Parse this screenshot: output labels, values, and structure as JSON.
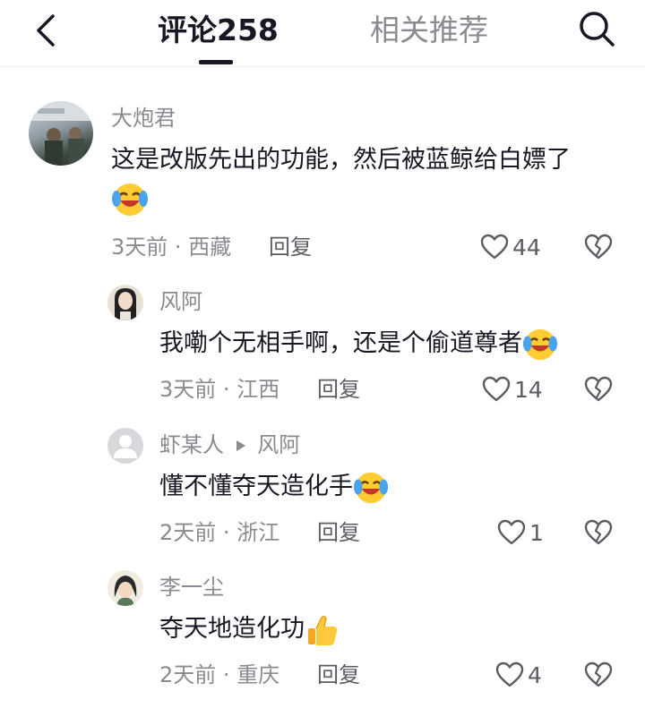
{
  "header": {
    "tab_comments": "评论258",
    "tab_related": "相关推荐"
  },
  "comments": [
    {
      "user": "大炮君",
      "text_line1": "这是改版先出的功能，然后被蓝鲸给白嫖了",
      "time": "3天前",
      "location": "西藏",
      "reply_label": "回复",
      "likes": "44",
      "emoji": "laughing-crying-emoji"
    },
    {
      "user": "风阿",
      "text": "我嘞个无相手啊，还是个偷道尊者",
      "time": "3天前",
      "location": "江西",
      "reply_label": "回复",
      "likes": "14",
      "emoji": "laughing-crying-emoji"
    },
    {
      "user": "虾某人",
      "reply_to": "风阿",
      "text": "懂不懂夺天造化手",
      "time": "2天前",
      "location": "浙江",
      "reply_label": "回复",
      "likes": "1",
      "emoji": "laughing-crying-emoji"
    },
    {
      "user": "李一尘",
      "text": "夺天地造化功",
      "time": "2天前",
      "location": "重庆",
      "reply_label": "回复",
      "likes": "4",
      "emoji": "thumbs-up-emoji"
    }
  ],
  "separator": "·"
}
